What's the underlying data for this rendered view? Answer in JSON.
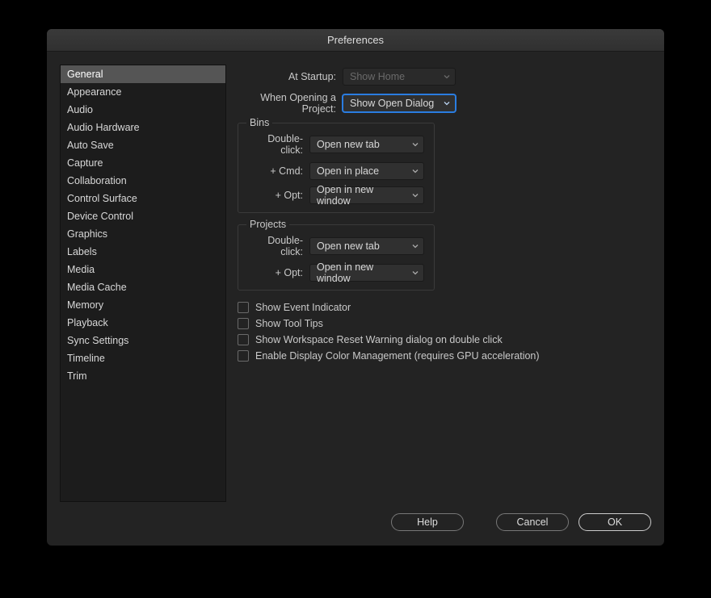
{
  "title": "Preferences",
  "sidebar": {
    "items": [
      "General",
      "Appearance",
      "Audio",
      "Audio Hardware",
      "Auto Save",
      "Capture",
      "Collaboration",
      "Control Surface",
      "Device Control",
      "Graphics",
      "Labels",
      "Media",
      "Media Cache",
      "Memory",
      "Playback",
      "Sync Settings",
      "Timeline",
      "Trim"
    ],
    "selected_index": 0
  },
  "form": {
    "startup_label": "At Startup:",
    "startup_value": "Show Home",
    "open_project_label": "When Opening a Project:",
    "open_project_value": "Show Open Dialog",
    "bins": {
      "title": "Bins",
      "double_click_label": "Double-click:",
      "double_click_value": "Open new tab",
      "cmd_label": "+ Cmd:",
      "cmd_value": "Open in place",
      "opt_label": "+ Opt:",
      "opt_value": "Open in new window"
    },
    "projects": {
      "title": "Projects",
      "double_click_label": "Double-click:",
      "double_click_value": "Open new tab",
      "opt_label": "+ Opt:",
      "opt_value": "Open in new window"
    },
    "checks": {
      "event_indicator": "Show Event Indicator",
      "tool_tips": "Show Tool Tips",
      "workspace_warning": "Show Workspace Reset Warning dialog on double click",
      "color_mgmt": "Enable Display Color Management (requires GPU acceleration)"
    }
  },
  "buttons": {
    "help": "Help",
    "cancel": "Cancel",
    "ok": "OK"
  }
}
